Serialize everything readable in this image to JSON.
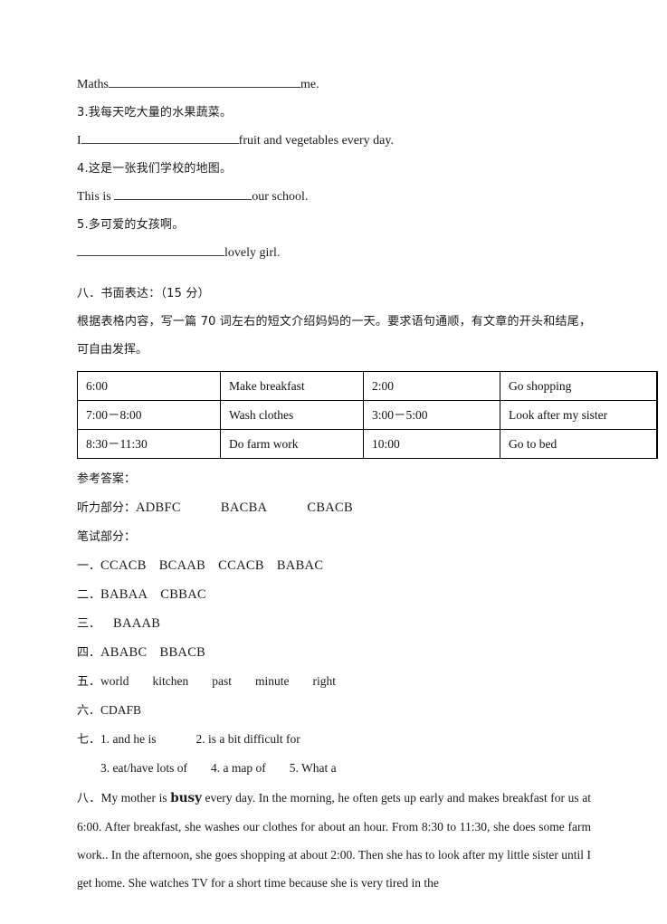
{
  "fill_in_blanks": {
    "items": [
      {
        "id": "maths-line",
        "prefix": "Maths",
        "blank_width": 212,
        "suffix": "me."
      },
      {
        "id": "q3-chinese",
        "text": "3.我每天吃大量的水果蔬菜。"
      },
      {
        "id": "q3-english",
        "prefix": "I",
        "blank_width": 174,
        "suffix": "fruit and vegetables every day."
      },
      {
        "id": "q4-chinese",
        "text": "4.这是一张我们学校的地图。"
      },
      {
        "id": "q4-english",
        "prefix": "This is ",
        "blank_width": 152,
        "suffix": "our school."
      },
      {
        "id": "q5-chinese",
        "text": "5.多可爱的女孩啊。"
      },
      {
        "id": "q5-english",
        "prefix": "",
        "blank_width": 163,
        "suffix": "lovely girl."
      }
    ]
  },
  "writing_task": {
    "heading": "八．书面表达：（15 分）",
    "instruction": "根据表格内容，写一篇 70 词左右的短文介绍妈妈的一天。要求语句通顺，有文章的开头和结尾，可自由发挥。"
  },
  "schedule_table": {
    "rows": [
      [
        "6:00",
        "Make breakfast",
        "2:00",
        "Go shopping"
      ],
      [
        "7:00－8:00",
        "Wash clothes",
        "3:00－5:00",
        "Look after my sister"
      ],
      [
        "8:30－11:30",
        "Do farm work",
        "10:00",
        "Go to bed"
      ]
    ]
  },
  "answer_key": {
    "title": "参考答案：",
    "listening_label": "听力部分：",
    "listening_values": [
      "ADBFC",
      "BACBA",
      "CBACB"
    ],
    "written_label": "笔试部分：",
    "sections": [
      {
        "label": "一．",
        "values": [
          "CCACB",
          "BCAAB",
          "CCACB",
          "BABAC"
        ]
      },
      {
        "label": "二．",
        "values": [
          "BABAA",
          "CBBAC"
        ]
      },
      {
        "label": "三．",
        "values": [
          "BAAAB"
        ]
      },
      {
        "label": "四．",
        "values": [
          "ABABC",
          "BBACB"
        ]
      },
      {
        "label": "五．",
        "values": [
          "world",
          "kitchen",
          "past",
          "minute",
          "right"
        ]
      },
      {
        "label": "六．",
        "values": [
          "CDAFB"
        ]
      }
    ],
    "section_seven": {
      "label": "七．",
      "line1": [
        "1. and he is",
        "2. is a bit difficult for"
      ],
      "line2": [
        "3. eat/have lots of",
        "4. a map of",
        "5. What a"
      ]
    },
    "section_eight": {
      "label": "八．",
      "essay_part1": "My mother is ",
      "essay_bold": "busy",
      "essay_part2": " every day. In the morning, he often gets up early and makes breakfast for us at 6:00. After breakfast, she washes our clothes for about an hour. From 8:30 to 11:30, she does some farm work.. In the afternoon, she goes shopping at about 2:00. Then she has to look after my little sister until I get home. She watches TV for a short time because she is very tired in the"
    }
  }
}
